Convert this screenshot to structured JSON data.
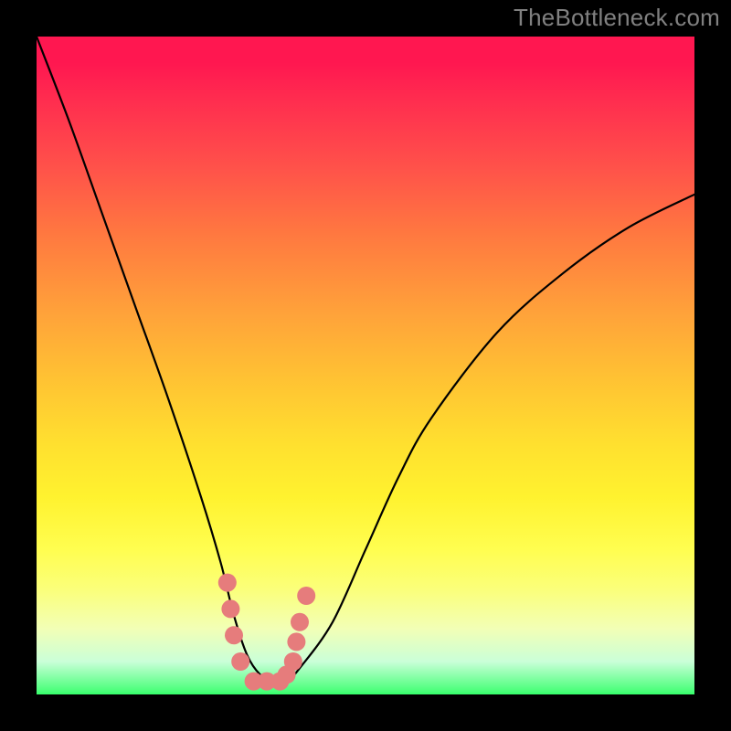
{
  "watermark": "TheBottleneck.com",
  "colors": {
    "background": "#000000",
    "curve": "#000000",
    "markers": "#e67c7c",
    "gradient_top": "#ff1750",
    "gradient_bottom": "#3bff6f"
  },
  "chart_data": {
    "type": "line",
    "title": "",
    "xlabel": "",
    "ylabel": "",
    "xlim": [
      0,
      100
    ],
    "ylim": [
      0,
      100
    ],
    "x": [
      0,
      5,
      10,
      15,
      20,
      25,
      28,
      30,
      32,
      34,
      36,
      38,
      40,
      45,
      50,
      55,
      60,
      70,
      80,
      90,
      100
    ],
    "series": [
      {
        "name": "bottleneck-curve",
        "values": [
          100,
          87,
          73,
          59,
          45,
          30,
          20,
          12,
          6,
          3,
          2,
          2,
          4,
          11,
          22,
          33,
          42,
          55,
          64,
          71,
          76
        ]
      }
    ],
    "markers": [
      {
        "x": 29,
        "y": 17
      },
      {
        "x": 29.5,
        "y": 13
      },
      {
        "x": 30,
        "y": 9
      },
      {
        "x": 31,
        "y": 5
      },
      {
        "x": 33,
        "y": 2
      },
      {
        "x": 35,
        "y": 2
      },
      {
        "x": 37,
        "y": 2
      },
      {
        "x": 38,
        "y": 3
      },
      {
        "x": 39,
        "y": 5
      },
      {
        "x": 39.5,
        "y": 8
      },
      {
        "x": 40,
        "y": 11
      },
      {
        "x": 41,
        "y": 15
      }
    ],
    "grid": false,
    "legend": false
  }
}
